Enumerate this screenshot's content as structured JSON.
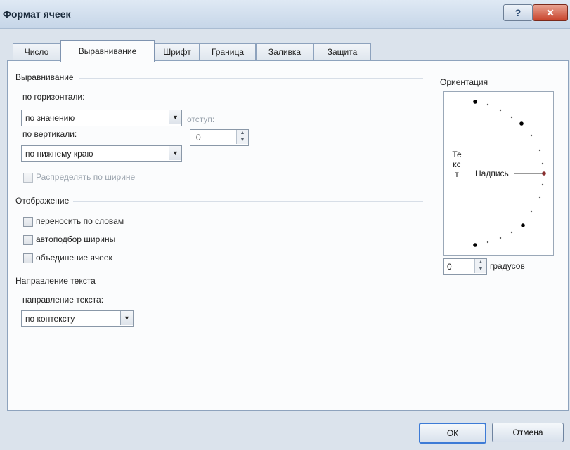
{
  "title": "Формат ячеек",
  "titlebar": {
    "help_label": "?",
    "close_label": "✕"
  },
  "tabs": [
    "Число",
    "Выравнивание",
    "Шрифт",
    "Граница",
    "Заливка",
    "Защита"
  ],
  "active_tab": 1,
  "alignment": {
    "section": "Выравнивание",
    "horizontal_label": "по горизонтали:",
    "horizontal_value": "по значению",
    "indent_label": "отступ:",
    "indent_value": "0",
    "vertical_label": "по вертикали:",
    "vertical_value": "по нижнему краю",
    "distribute_label": "Распределять по ширине"
  },
  "display": {
    "section": "Отображение",
    "options": [
      "переносить по словам",
      "автоподбор ширины",
      "объединение ячеек"
    ]
  },
  "direction": {
    "section": "Направление текста",
    "label": "направление текста:",
    "value": "по контексту"
  },
  "orientation": {
    "section": "Ориентация",
    "vertical_text": "Текст",
    "label": "Надпись",
    "degrees_value": "0",
    "degrees_label": "градусов"
  },
  "buttons": {
    "ok": "ОК",
    "cancel": "Отмена"
  },
  "icons": {
    "dropdown": "chevron-down-icon",
    "spinner": "spinner-arrows-icon",
    "checkbox": "checkbox-unchecked-icon"
  }
}
